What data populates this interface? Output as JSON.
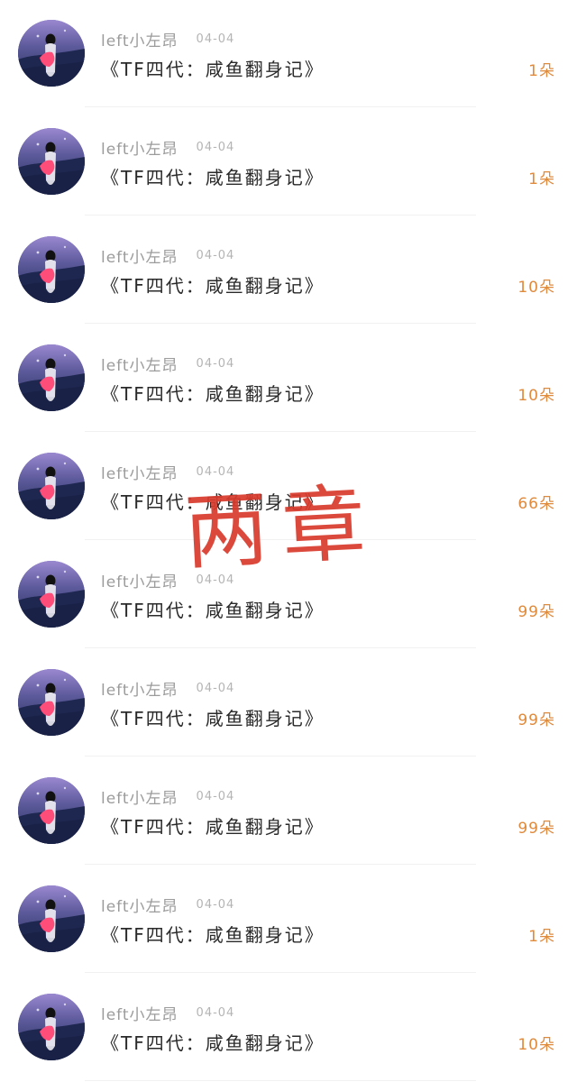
{
  "overlay_text": "两章",
  "accent_color": "#e08a3c",
  "overlay_color": "#d93a2d",
  "items": [
    {
      "username": "left小左昂",
      "date": "04-04",
      "title": "《TF四代：咸鱼翻身记》",
      "gift": "1朵"
    },
    {
      "username": "left小左昂",
      "date": "04-04",
      "title": "《TF四代：咸鱼翻身记》",
      "gift": "1朵"
    },
    {
      "username": "left小左昂",
      "date": "04-04",
      "title": "《TF四代：咸鱼翻身记》",
      "gift": "10朵"
    },
    {
      "username": "left小左昂",
      "date": "04-04",
      "title": "《TF四代：咸鱼翻身记》",
      "gift": "10朵"
    },
    {
      "username": "left小左昂",
      "date": "04-04",
      "title": "《TF四代：咸鱼翻身记》",
      "gift": "66朵"
    },
    {
      "username": "left小左昂",
      "date": "04-04",
      "title": "《TF四代：咸鱼翻身记》",
      "gift": "99朵"
    },
    {
      "username": "left小左昂",
      "date": "04-04",
      "title": "《TF四代：咸鱼翻身记》",
      "gift": "99朵"
    },
    {
      "username": "left小左昂",
      "date": "04-04",
      "title": "《TF四代：咸鱼翻身记》",
      "gift": "99朵"
    },
    {
      "username": "left小左昂",
      "date": "04-04",
      "title": "《TF四代：咸鱼翻身记》",
      "gift": "1朵"
    },
    {
      "username": "left小左昂",
      "date": "04-04",
      "title": "《TF四代：咸鱼翻身记》",
      "gift": "10朵"
    }
  ]
}
